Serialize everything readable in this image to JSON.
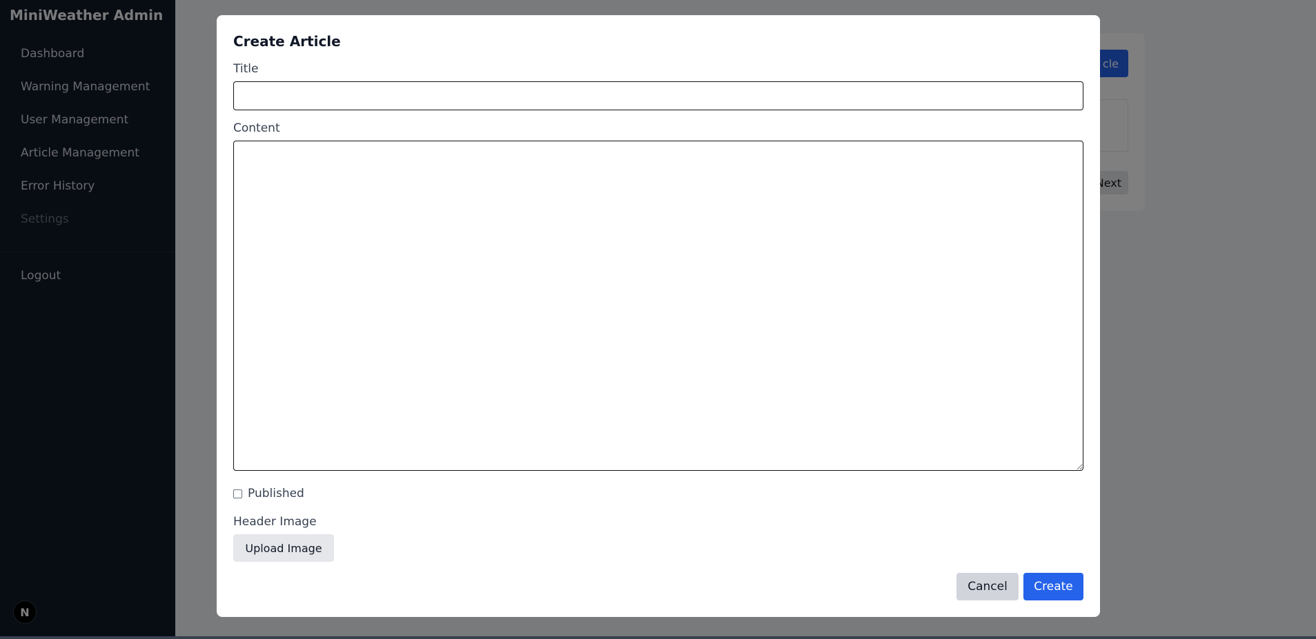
{
  "sidebar": {
    "brand": "MiniWeather Admin",
    "items": [
      {
        "label": "Dashboard"
      },
      {
        "label": "Warning Management"
      },
      {
        "label": "User Management"
      },
      {
        "label": "Article Management"
      },
      {
        "label": "Error History"
      },
      {
        "label": "Settings"
      }
    ],
    "logout": "Logout",
    "badge": "N"
  },
  "background": {
    "primary_button": "cle",
    "next_button": "Next"
  },
  "modal": {
    "title": "Create Article",
    "title_label": "Title",
    "title_value": "",
    "content_label": "Content",
    "content_value": "",
    "published_label": "Published",
    "published_checked": false,
    "header_image_label": "Header Image",
    "upload_button": "Upload Image",
    "cancel_button": "Cancel",
    "create_button": "Create"
  },
  "colors": {
    "sidebar_bg": "#111827",
    "primary": "#2563eb",
    "overlay": "rgba(0,0,0,0.5)"
  }
}
